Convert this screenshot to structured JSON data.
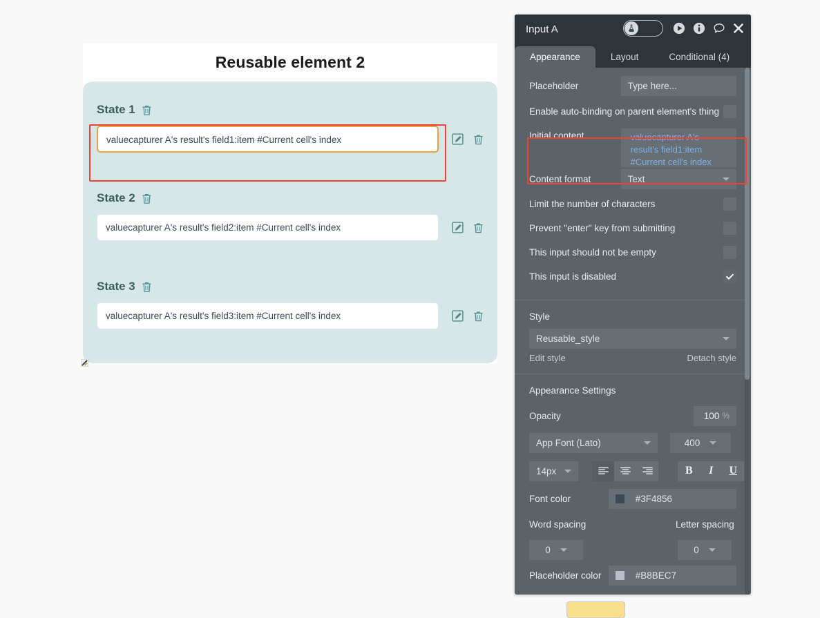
{
  "canvas": {
    "reusable_title": "Reusable element 2",
    "states": [
      {
        "label": "State 1",
        "value": "valuecapturer A's result's field1:item #Current cell's index"
      },
      {
        "label": "State 2",
        "value": "valuecapturer A's result's field2:item #Current cell's index"
      },
      {
        "label": "State 3",
        "value": "valuecapturer A's result's field3:item #Current cell's index"
      }
    ],
    "icons": {
      "state_delete": "trash-icon",
      "row_edit": "edit-pencil-icon",
      "row_delete": "trash-icon",
      "resize_handle": "resize-handle-icon"
    }
  },
  "panel": {
    "title": "Input A",
    "header_icons": {
      "experimental_toggle": "flask-toggle-icon",
      "preview": "play-icon",
      "info": "info-icon",
      "comment": "comment-icon",
      "close": "close-icon"
    },
    "tabs": [
      {
        "label": "Appearance",
        "active": true
      },
      {
        "label": "Layout",
        "active": false
      },
      {
        "label": "Conditional (4)",
        "active": false
      }
    ],
    "properties": {
      "placeholder_label": "Placeholder",
      "placeholder_value": "Type here...",
      "autobinding_label": "Enable auto-binding on parent element's thing",
      "autobinding_checked": false,
      "initial_content_label": "Initial content",
      "initial_content_value": "valuecapturer A's result's field1:item #Current cell's index",
      "content_format_label": "Content format",
      "content_format_value": "Text",
      "limit_chars_label": "Limit the number of characters",
      "limit_chars_checked": false,
      "prevent_enter_label": "Prevent \"enter\" key from submitting",
      "prevent_enter_checked": false,
      "not_empty_label": "This input should not be empty",
      "not_empty_checked": false,
      "disabled_label": "This input is disabled",
      "disabled_checked": true
    },
    "style_section": {
      "heading": "Style",
      "style_value": "Reusable_style",
      "edit_style": "Edit style",
      "detach_style": "Detach style"
    },
    "appearance_settings": {
      "heading": "Appearance Settings",
      "opacity_label": "Opacity",
      "opacity_value": "100",
      "opacity_unit": "%",
      "font_family": "App Font (Lato)",
      "font_weight": "400",
      "font_size": "14px",
      "align_left_icon": "align-left-icon",
      "align_center_icon": "align-center-icon",
      "align_right_icon": "align-right-icon",
      "bold_label": "B",
      "italic_label": "I",
      "underline_label": "U",
      "font_color_label": "Font color",
      "font_color_value": "#3F4856",
      "word_spacing_label": "Word spacing",
      "word_spacing_value": "0",
      "letter_spacing_label": "Letter spacing",
      "letter_spacing_value": "0",
      "placeholder_color_label": "Placeholder color",
      "placeholder_color_value": "#B8BEC7"
    },
    "colors": {
      "panel_bg": "#5B6268",
      "header_bg": "#2E343A",
      "field_bg": "#676E74",
      "accent_red": "#EF4136",
      "expression_blue": "#7FB2E5",
      "font_color_swatch": "#3F4856",
      "placeholder_color_swatch": "#B8BEC7"
    }
  }
}
